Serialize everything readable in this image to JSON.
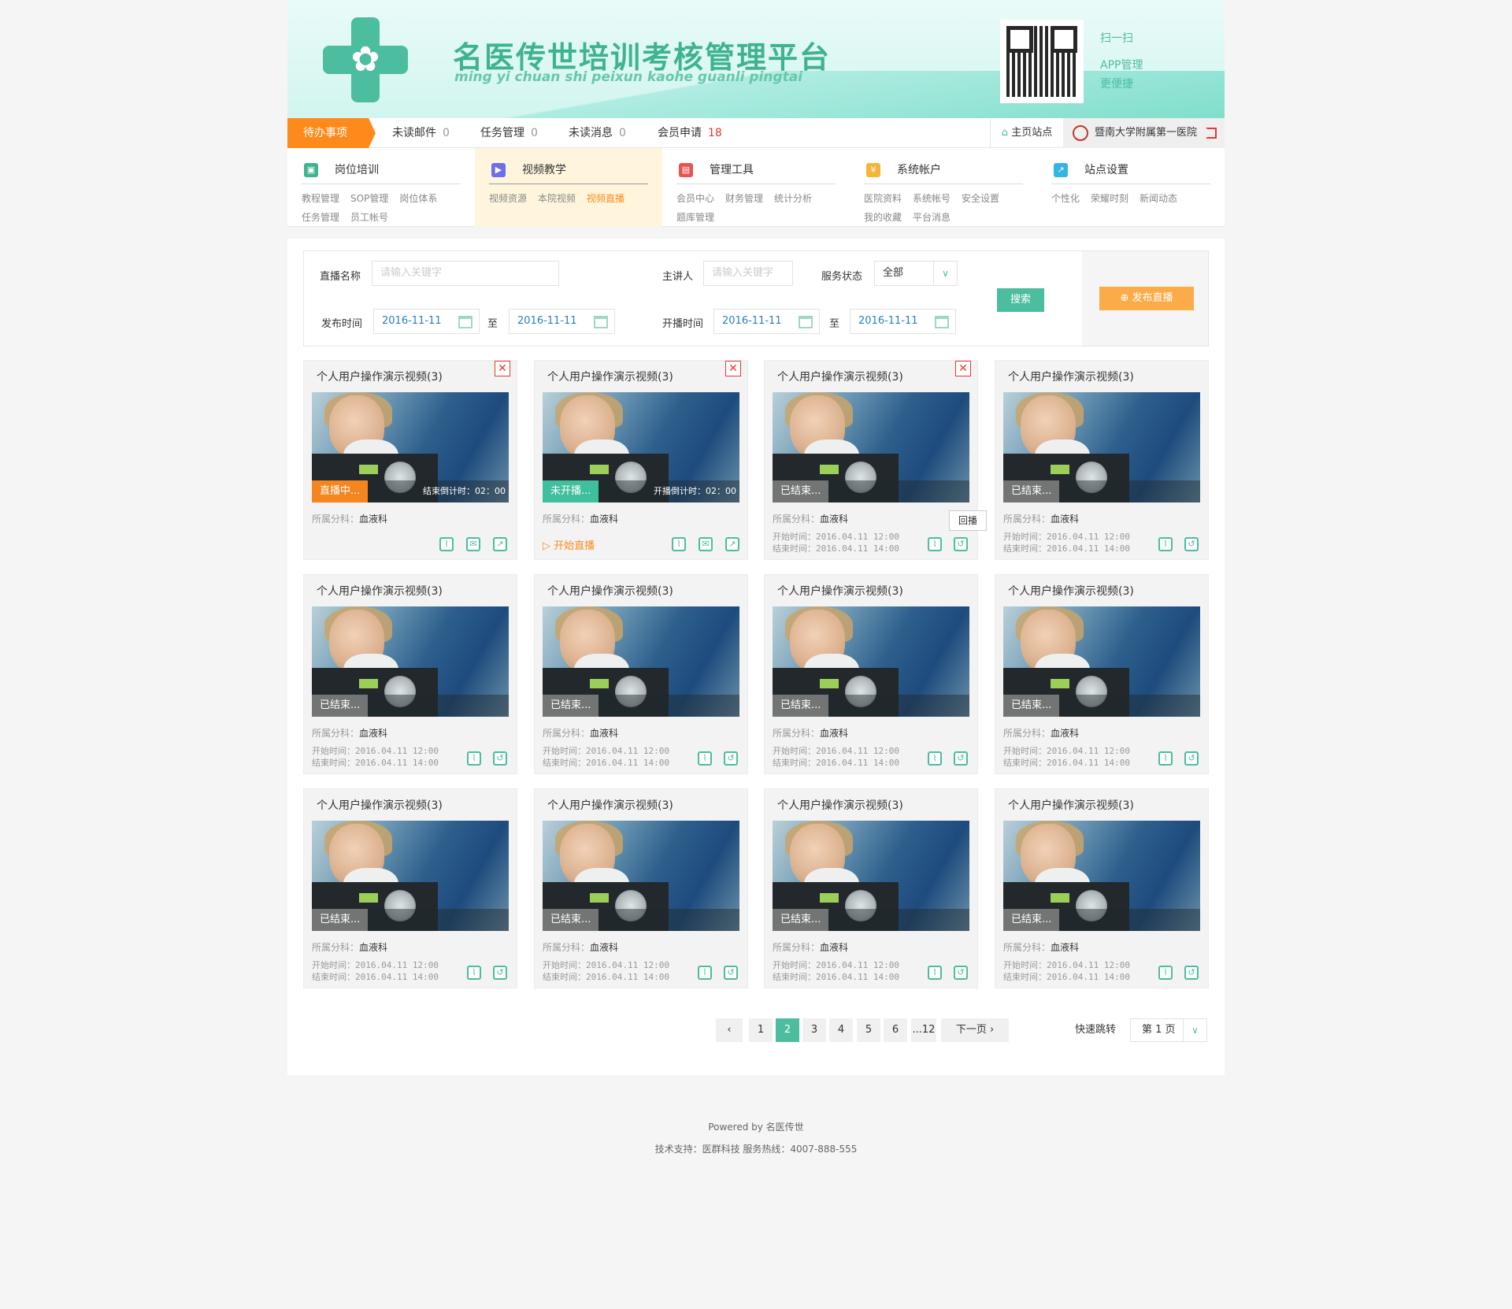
{
  "header": {
    "title": "名医传世培训考核管理平台",
    "subtitle": "ming yi chuan shi peixun kaohe guanli pingtai",
    "qr_lines": [
      "扫一扫",
      "APP管理",
      "更便捷"
    ]
  },
  "navbar": {
    "todo": "待办事项",
    "items": [
      {
        "label": "未读邮件",
        "count": "0"
      },
      {
        "label": "任务管理",
        "count": "0"
      },
      {
        "label": "未读消息",
        "count": "0"
      },
      {
        "label": "会员申请",
        "count": "18"
      }
    ],
    "home": "主页站点",
    "hospital": "暨南大学附属第一医院"
  },
  "menu": [
    {
      "title": "岗位培训",
      "icon_color": "#3fb391",
      "links": [
        "教程管理",
        "SOP管理",
        "岗位体系",
        "任务管理",
        "员工帐号"
      ]
    },
    {
      "title": "视频教学",
      "icon_color": "#6d6ee8",
      "links": [
        "视频资源",
        "本院视频",
        "视频直播"
      ],
      "active_link": "视频直播"
    },
    {
      "title": "管理工具",
      "icon_color": "#e65454",
      "links": [
        "会员中心",
        "财务管理",
        "统计分析",
        "题库管理"
      ]
    },
    {
      "title": "系统帐户",
      "icon_color": "#f5b638",
      "links": [
        "医院资料",
        "系统帐号",
        "安全设置",
        "我的收藏",
        "平台消息"
      ]
    },
    {
      "title": "站点设置",
      "icon_color": "#33b5e5",
      "links": [
        "个性化",
        "荣耀时刻",
        "新闻动态"
      ]
    }
  ],
  "search": {
    "live_name_label": "直播名称",
    "live_name_placeholder": "请输入关键字",
    "host_label": "主讲人",
    "host_placeholder": "请输入关键字",
    "status_label": "服务状态",
    "status_value": "全部",
    "publish_label": "发布时间",
    "publish_from": "2016-11-11",
    "publish_to": "2016-11-11",
    "to": "至",
    "start_label": "开播时间",
    "start_from": "2016-11-11",
    "start_to": "2016-11-11",
    "search_button": "搜索",
    "publish_button": "发布直播"
  },
  "cards_common": {
    "title": "个人用户操作演示视频(3)",
    "dept_label": "所属分科：",
    "dept": "血液科",
    "start_label": "开始时间：",
    "start": "2016.04.11 12:00",
    "end_label": "结束时间：",
    "end": "2016.04.11 14:00"
  },
  "cards": [
    {
      "status": "直播中...",
      "countdown": "结束倒计时：02：00",
      "start_live": ""
    },
    {
      "status": "未开播...",
      "countdown": "开播倒计时：02：00",
      "start_live": "开始直播"
    },
    {
      "status": "已结束...",
      "tooltip": "回播"
    },
    {
      "status": "已结束..."
    },
    {
      "status": "已结束..."
    },
    {
      "status": "已结束..."
    },
    {
      "status": "已结束..."
    },
    {
      "status": "已结束..."
    },
    {
      "status": "已结束..."
    },
    {
      "status": "已结束..."
    },
    {
      "status": "已结束..."
    },
    {
      "status": "已结束..."
    }
  ],
  "pager": {
    "prev": "‹",
    "pages": [
      "1",
      "2",
      "3",
      "4",
      "5",
      "6",
      "...12"
    ],
    "current": "2",
    "next": "下一页 ›",
    "jump_label": "快速跳转",
    "jump_value": "第 1 页"
  },
  "footer": {
    "powered": "Powered by 名医传世",
    "support": "技术支持：医群科技 服务热线：4007-888-555"
  }
}
